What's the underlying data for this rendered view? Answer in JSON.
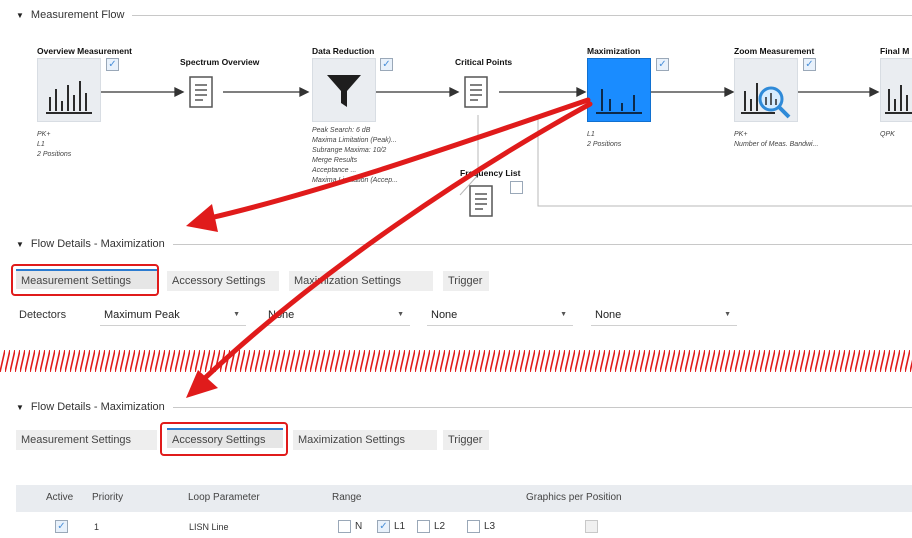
{
  "measurement_flow": {
    "title": "Measurement Flow",
    "nodes": [
      {
        "title": "Overview Measurement",
        "checked": true,
        "desc": [
          "PK+",
          "L1",
          "2 Positions"
        ]
      },
      {
        "title": "Spectrum Overview",
        "checked": false,
        "desc": []
      },
      {
        "title": "Data Reduction",
        "checked": true,
        "desc": [
          "Peak Search: 6 dB",
          "Maxima Limitation (Peak)...",
          "Subrange Maxima: 10/2",
          "Merge Results",
          "Acceptance ...",
          "Maxima Limitation (Accep..."
        ]
      },
      {
        "title": "Critical Points",
        "checked": false,
        "desc": []
      },
      {
        "title": "Maximization",
        "checked": true,
        "selected": true,
        "desc": [
          "L1",
          "2 Positions"
        ]
      },
      {
        "title": "Zoom Measurement",
        "checked": true,
        "desc": [
          "PK+",
          "Number of Meas. Bandwi..."
        ]
      },
      {
        "title": "Final M",
        "checked": false,
        "desc": [
          "QPK"
        ]
      }
    ],
    "frequency_list": {
      "title": "Frequency List",
      "checked": false
    }
  },
  "flow_details_1": {
    "title": "Flow Details  -  Maximization",
    "tabs": [
      "Measurement Settings",
      "Accessory Settings",
      "Maximization Settings",
      "Trigger"
    ],
    "active_tab": 0,
    "detectors_label": "Detectors",
    "detectors": [
      "Maximum Peak",
      "None",
      "None",
      "None"
    ]
  },
  "flow_details_2": {
    "title": "Flow Details  -  Maximization",
    "tabs": [
      "Measurement Settings",
      "Accessory Settings",
      "Maximization Settings",
      "Trigger"
    ],
    "active_tab": 1,
    "table": {
      "headers": [
        "Active",
        "Priority",
        "Loop Parameter",
        "Range",
        "Graphics per Position"
      ],
      "row": {
        "active": true,
        "priority": "1",
        "loop_parameter": "LISN Line",
        "range": [
          {
            "label": "N",
            "checked": false
          },
          {
            "label": "L1",
            "checked": true
          },
          {
            "label": "L2",
            "checked": false
          },
          {
            "label": "L3",
            "checked": false
          }
        ],
        "graphics": false
      }
    }
  },
  "colors": {
    "accent": "#2b7bd0",
    "annotation_red": "#e01b1b",
    "selected_node": "#1a8cff"
  },
  "icons": {
    "check": "✓",
    "triangle": "▼",
    "dropdown": "▼"
  }
}
